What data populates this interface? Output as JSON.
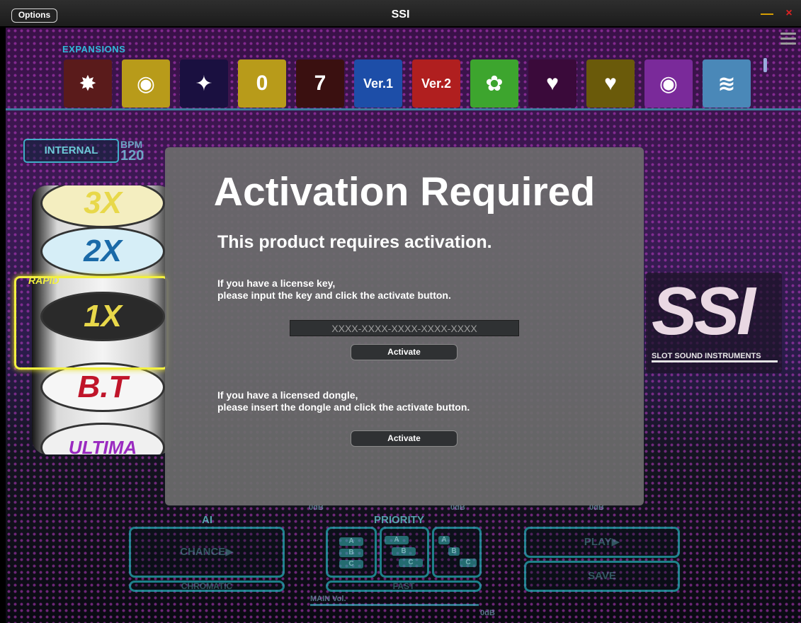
{
  "titlebar": {
    "options_label": "Options",
    "app_title": "SSI",
    "minimize_glyph": "—",
    "close_glyph": "×"
  },
  "background_app": {
    "expansions_label": "EXPANSIONS",
    "expansion_icons": [
      {
        "name": "burst-icon",
        "glyph": "✸",
        "color": "#5a1b1b"
      },
      {
        "name": "speaker-icon",
        "glyph": "◉",
        "color": "#b89b1a"
      },
      {
        "name": "star-icon",
        "glyph": "✦",
        "color": "#1a1040"
      },
      {
        "name": "zero-icon",
        "glyph": "0",
        "color": "#b89b1a"
      },
      {
        "name": "seven-icon",
        "glyph": "7",
        "color": "#3a1010"
      },
      {
        "name": "ver1-icon",
        "glyph": "Ver.1",
        "color": "#1d4ea8"
      },
      {
        "name": "ver2-icon",
        "glyph": "Ver.2",
        "color": "#b01f1f"
      },
      {
        "name": "flower-icon",
        "glyph": "✿",
        "color": "#3da52e"
      },
      {
        "name": "heart-magenta-icon",
        "glyph": "♥",
        "color": "#3a0a3a"
      },
      {
        "name": "heart-yellow-icon",
        "glyph": "♥",
        "color": "#6a5a0a"
      },
      {
        "name": "vortex-icon",
        "glyph": "◉",
        "color": "#7a2a9a"
      },
      {
        "name": "wave-icon",
        "glyph": "≋",
        "color": "#4a88b8"
      }
    ],
    "sync_mode": "INTERNAL",
    "bpm_label": "BPM",
    "bpm_value": "120",
    "reel_symbols": [
      "3X",
      "2X",
      "1X",
      "B.T",
      "ULTIMA"
    ],
    "rapid_label": "RAPID",
    "logo_letters": "SSI",
    "logo_subtitle": "SLOT SOUND INSTRUMENTS",
    "ai_label": "AI",
    "chance_label": "CHANCE▶",
    "chromatic_label": "CHROMATIC",
    "priority_label": "PRIORITY",
    "fast_label": "FAST",
    "play_label": "PLAY▶",
    "save_label": "SAVE",
    "main_vol_label": "MAIN Vol.",
    "odb_label": "0dB",
    "priority_buttons": [
      "A",
      "B",
      "C"
    ]
  },
  "dialog": {
    "title": "Activation Required",
    "subtitle": "This product requires activation.",
    "license_text_line1": "If you have a license key,",
    "license_text_line2": "please input the key and click the activate button.",
    "key_placeholder": "XXXX-XXXX-XXXX-XXXX-XXXX",
    "activate_key_label": "Activate",
    "dongle_text_line1": "If you have a licensed dongle,",
    "dongle_text_line2": "please insert the dongle and click the activate button.",
    "activate_dongle_label": "Activate"
  }
}
